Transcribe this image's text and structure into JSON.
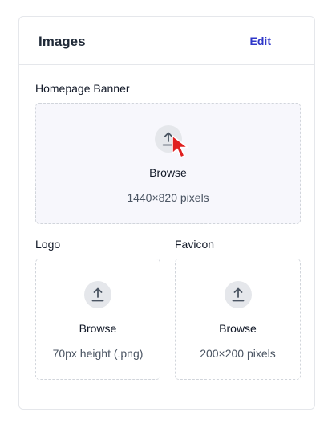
{
  "card": {
    "title": "Images",
    "edit_label": "Edit"
  },
  "banner": {
    "label": "Homepage Banner",
    "browse_label": "Browse",
    "hint": "1440×820 pixels",
    "icon": "upload-icon"
  },
  "logo": {
    "label": "Logo",
    "browse_label": "Browse",
    "hint": "70px height (.png)",
    "icon": "upload-icon"
  },
  "favicon": {
    "label": "Favicon",
    "browse_label": "Browse",
    "hint": "200×200 pixels",
    "icon": "upload-icon"
  },
  "colors": {
    "accent": "#2f37c9",
    "cursor": "#e02020",
    "border": "#e5e7eb"
  }
}
